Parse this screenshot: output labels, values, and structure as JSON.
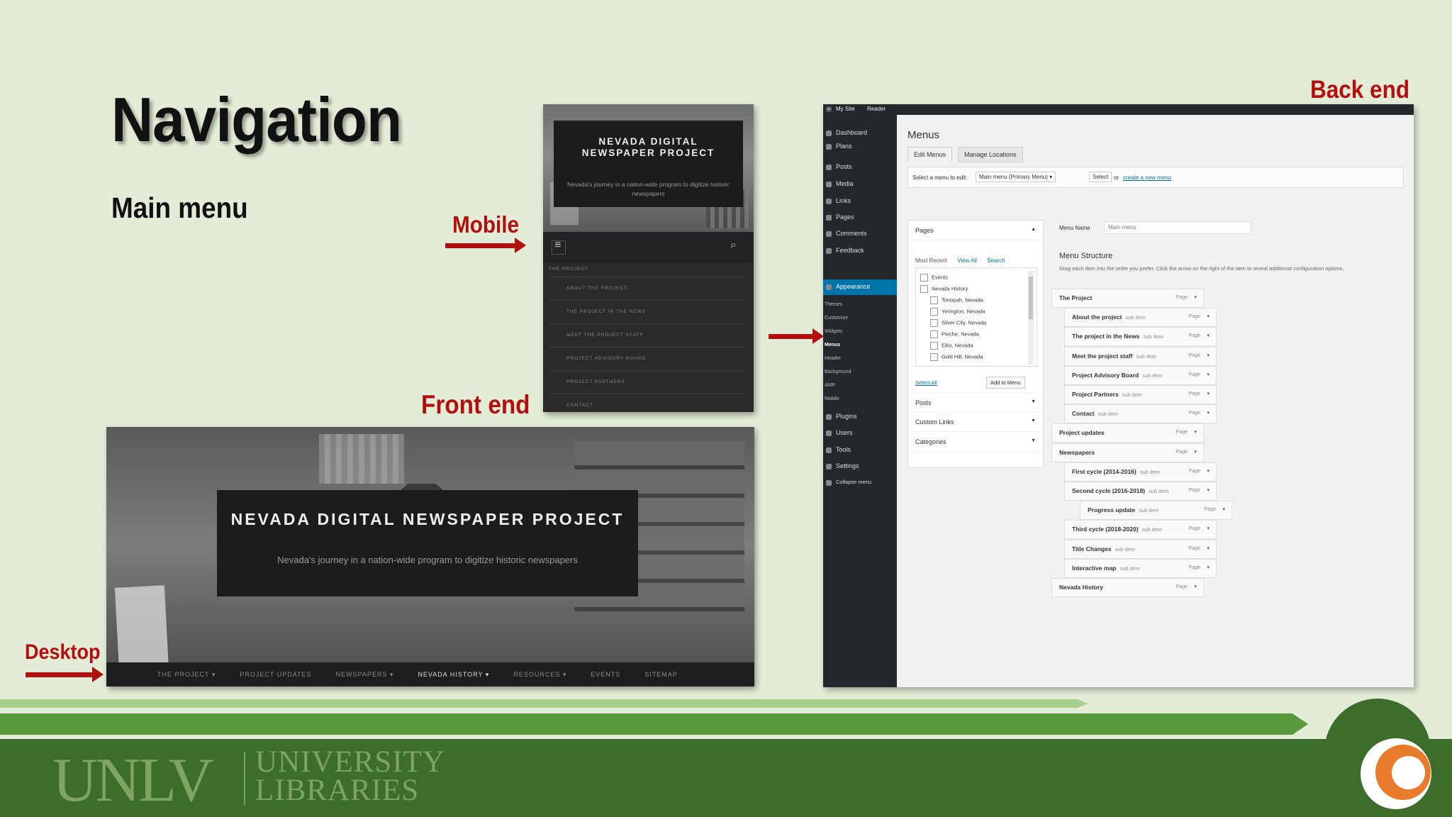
{
  "slide": {
    "title": "Navigation",
    "subtitle": "Main menu",
    "labels": {
      "mobile": "Mobile",
      "front_end": "Front end",
      "desktop": "Desktop",
      "back_end": "Back end"
    },
    "colors": {
      "background": "#e2ecd6",
      "accent_red": "#b30f0f",
      "footer_green": "#3c6d2a"
    }
  },
  "mobile": {
    "site_title": "NEVADA DIGITAL NEWSPAPER PROJECT",
    "tagline": "Nevada's journey in a nation-wide program to digitize historic newspapers",
    "menu_top": "The Project",
    "menu_items": [
      "About the project",
      "The project in the news",
      "Meet the project staff",
      "Project advisory board",
      "Project partners",
      "Contact"
    ]
  },
  "desktop": {
    "site_title": "NEVADA DIGITAL NEWSPAPER PROJECT",
    "tagline": "Nevada's journey in a nation-wide program to digitize historic newspapers",
    "nav": [
      "The Project ▾",
      "Project Updates",
      "Newspapers ▾",
      "Nevada History ▾",
      "Resources ▾",
      "Events",
      "Sitemap"
    ]
  },
  "backend": {
    "topbar": {
      "my_site": "My Site",
      "reader": "Reader"
    },
    "sidebar": [
      "Dashboard",
      "Plans",
      "Posts",
      "Media",
      "Links",
      "Pages",
      "Comments",
      "Feedback",
      "Appearance",
      "Plugins",
      "Users",
      "Tools",
      "Settings",
      "Collapse menu"
    ],
    "sidebar_sub": [
      "Themes",
      "Customize",
      "Widgets",
      "Menus",
      "Header",
      "Background",
      "AMP",
      "Mobile"
    ],
    "heading": "Menus",
    "tabs": [
      "Edit Menus",
      "Manage Locations"
    ],
    "select_label": "Select a menu to edit:",
    "select_value": "Main menu (Primary Menu) ▾",
    "select_button": "Select",
    "or_text": "or",
    "create_link": "create a new menu",
    "left_panel": {
      "pages": "Pages",
      "tabs": [
        "Most Recent",
        "View All",
        "Search"
      ],
      "items": [
        "Events",
        "Nevada History",
        "Tonopah, Nevada",
        "Yerington, Nevada",
        "Silver City, Nevada",
        "Pioche, Nevada",
        "Elko, Nevada",
        "Gold Hill, Nevada"
      ],
      "select_all": "Select All",
      "add_button": "Add to Menu",
      "sections": [
        "Posts",
        "Custom Links",
        "Categories"
      ]
    },
    "menu_name_label": "Menu Name",
    "menu_name_value": "Main menu",
    "structure_heading": "Menu Structure",
    "structure_desc": "Drag each item into the order you prefer. Click the arrow on the right of the item to reveal additional configuration options.",
    "sub_item": "sub item",
    "item_type": "Page",
    "menu_items": [
      {
        "label": "The Project",
        "sub": false
      },
      {
        "label": "About the project",
        "sub": true
      },
      {
        "label": "The project in the News",
        "sub": true
      },
      {
        "label": "Meet the project staff",
        "sub": true
      },
      {
        "label": "Project Advisory Board",
        "sub": true
      },
      {
        "label": "Project Partners",
        "sub": true
      },
      {
        "label": "Contact",
        "sub": true
      },
      {
        "label": "Project updates",
        "sub": false
      },
      {
        "label": "Newspapers",
        "sub": false
      },
      {
        "label": "First cycle (2014-2016)",
        "sub": true
      },
      {
        "label": "Second cycle (2016-2018)",
        "sub": true
      },
      {
        "label": "Progress update",
        "sub": true
      },
      {
        "label": "Third cycle (2018-2020)",
        "sub": true
      },
      {
        "label": "Title Changes",
        "sub": true
      },
      {
        "label": "Interactive map",
        "sub": true
      },
      {
        "label": "Nevada History",
        "sub": false
      }
    ]
  },
  "footer": {
    "logo_unlv": "UNLV",
    "logo_line1": "UNIVERSITY",
    "logo_line2": "LIBRARIES"
  }
}
